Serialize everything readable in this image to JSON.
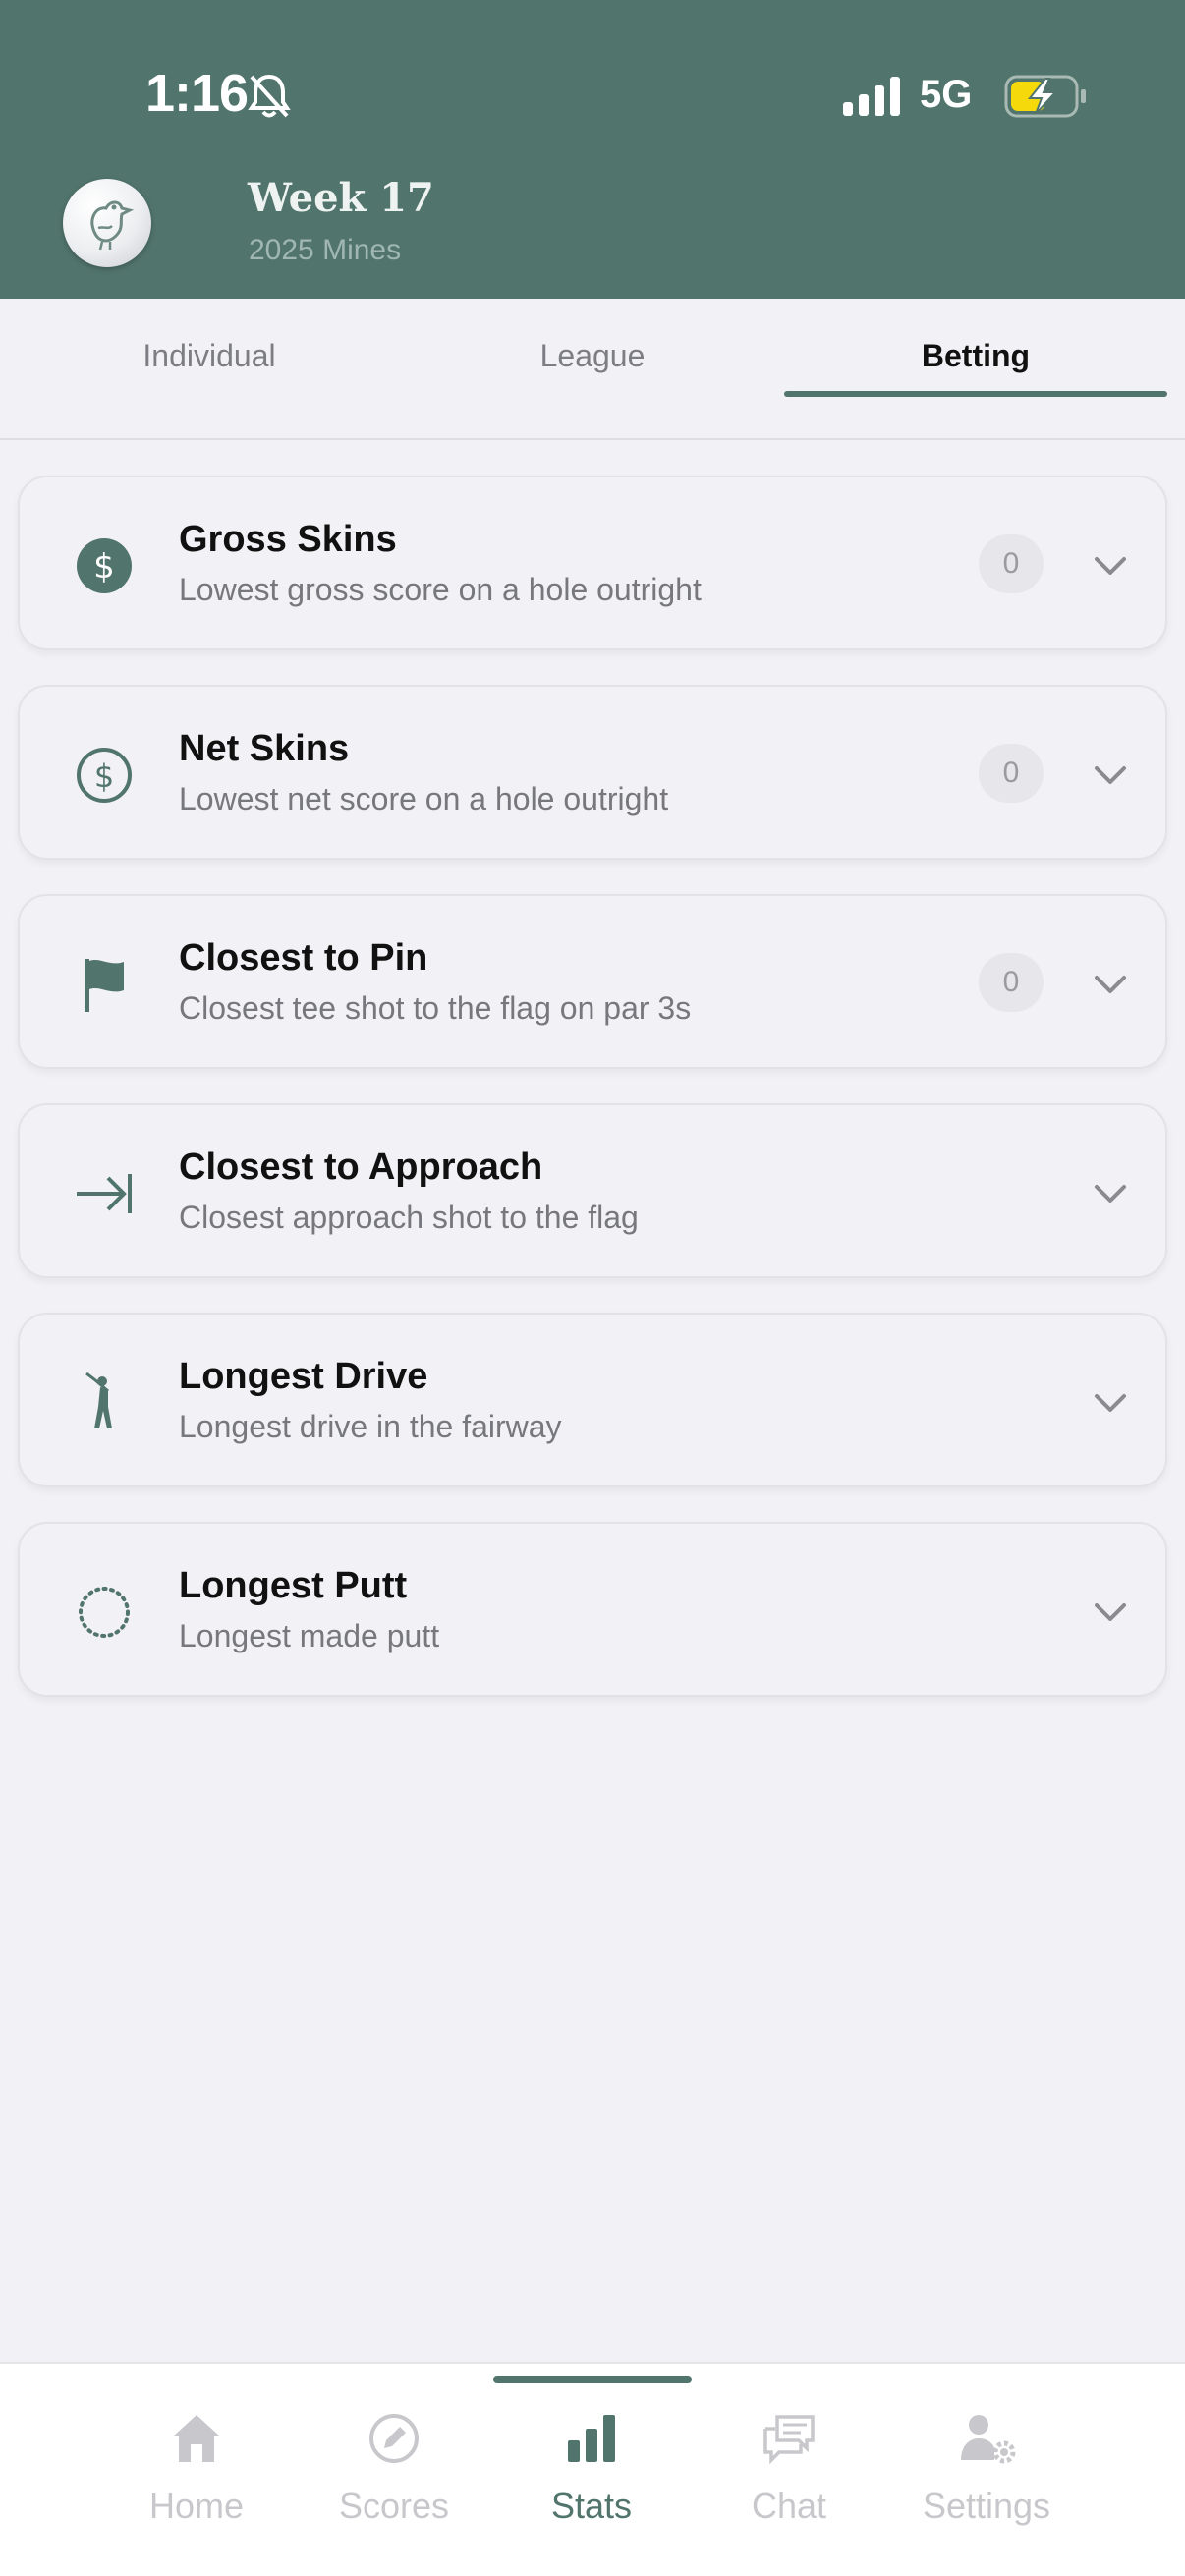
{
  "status_bar": {
    "time": "1:16",
    "network": "5G"
  },
  "header": {
    "title": "Week 17",
    "subtitle": "2025 Mines"
  },
  "tabs": [
    {
      "label": "Individual",
      "active": false
    },
    {
      "label": "League",
      "active": false
    },
    {
      "label": "Betting",
      "active": true
    }
  ],
  "bets": [
    {
      "title": "Gross Skins",
      "description": "Lowest gross score on a hole outright",
      "count": "0",
      "icon": "dollar-filled-icon"
    },
    {
      "title": "Net Skins",
      "description": "Lowest net score on a hole outright",
      "count": "0",
      "icon": "dollar-outline-icon"
    },
    {
      "title": "Closest to Pin",
      "description": "Closest tee shot to the flag on par 3s",
      "count": "0",
      "icon": "flag-icon"
    },
    {
      "title": "Closest to Approach",
      "description": "Closest approach shot to the flag",
      "icon": "arrow-to-line-icon"
    },
    {
      "title": "Longest Drive",
      "description": "Longest drive in the fairway",
      "icon": "golfer-icon"
    },
    {
      "title": "Longest Putt",
      "description": "Longest made putt",
      "icon": "dotted-circle-icon"
    }
  ],
  "bottom_nav": [
    {
      "label": "Home",
      "icon": "home-icon",
      "active": false
    },
    {
      "label": "Scores",
      "icon": "pencil-circle-icon",
      "active": false
    },
    {
      "label": "Stats",
      "icon": "bar-chart-icon",
      "active": true
    },
    {
      "label": "Chat",
      "icon": "chat-icon",
      "active": false
    },
    {
      "label": "Settings",
      "icon": "user-gear-icon",
      "active": false
    }
  ],
  "colors": {
    "brand": "#51756c",
    "background": "#f2f1f6",
    "battery_fill": "#f5d90a"
  }
}
